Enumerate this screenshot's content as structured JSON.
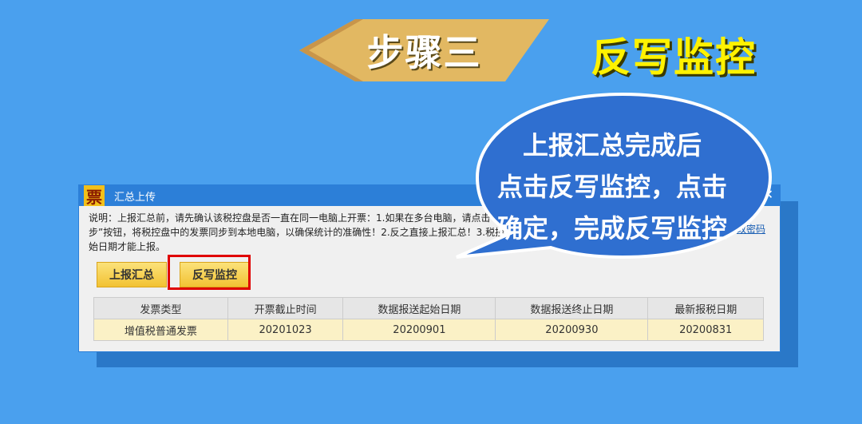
{
  "banner": {
    "step_label": "步骤三",
    "step_title": "反写监控"
  },
  "window": {
    "app_icon_char": "票",
    "title": "汇总上传",
    "minimize_glyph": "—",
    "close_glyph": "✕",
    "notice_line1": "说明：上报汇总前，请先确认该税控盘是否一直在同一电脑上开票：1.如果在多台电脑",
    "notice_line1_tail": "，请点击",
    "notice_line2": "步”按钮，将税控盘中的发票同步到本地电脑，以确保统计的准确性！2.反之直接上报汇总！3.税控盘日期大于数据报送起",
    "notice_line3": "始日期才能上报。",
    "pwd_link": "改密码",
    "buttons": {
      "upload_summary": "上报汇总",
      "reverse_monitor": "反写监控"
    },
    "table": {
      "headers": [
        "发票类型",
        "开票截止时间",
        "数据报送起始日期",
        "数据报送终止日期",
        "最新报税日期"
      ],
      "rows": [
        [
          "增值税普通发票",
          "20201023",
          "20200901",
          "20200930",
          "20200831"
        ]
      ]
    }
  },
  "callout": {
    "line1": "上报汇总完成后",
    "line2": "点击反写监控，点击",
    "line3": "确定，完成反写监控"
  },
  "colors": {
    "background": "#4aa0ee",
    "title_yellow": "#fff200",
    "window_blue": "#2c7fd8",
    "highlight_red": "#e00000",
    "bubble_blue": "#2f6fd0"
  }
}
